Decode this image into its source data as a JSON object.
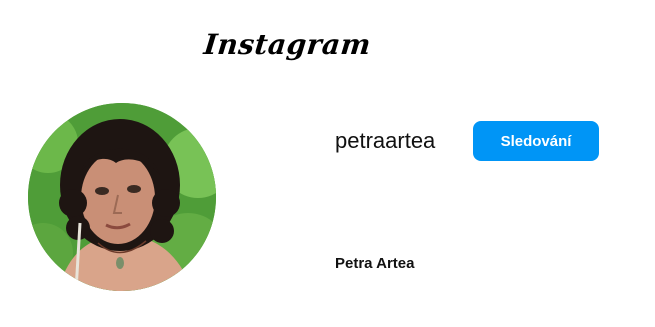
{
  "header": {
    "logo_text": "Instagram"
  },
  "profile": {
    "avatar_alt": "petraartea",
    "username": "petraartea",
    "full_name": "Petra Artea",
    "follow_label": "Sledování"
  },
  "colors": {
    "accent": "#0095f6",
    "background": "#ffffff",
    "text": "#111111"
  }
}
